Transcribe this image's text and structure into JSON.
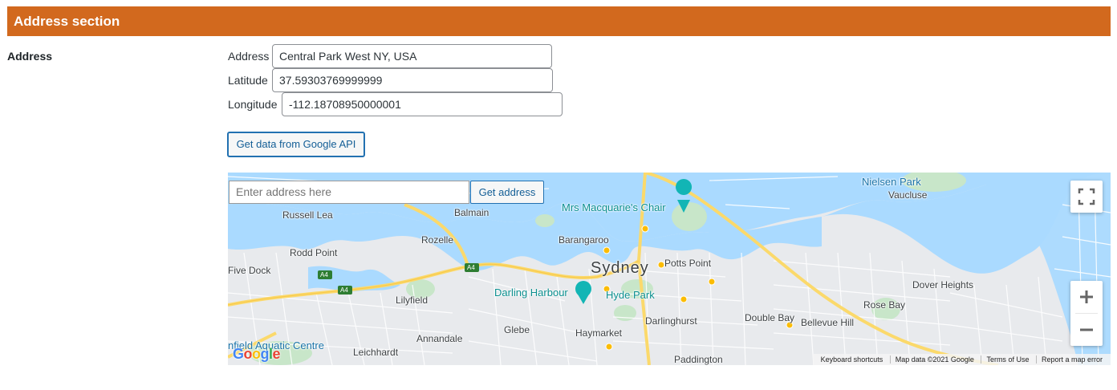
{
  "section": {
    "title": "Address section"
  },
  "field": {
    "label": "Address"
  },
  "address": {
    "label": "Address",
    "value": "Central Park West NY, USA"
  },
  "latitude": {
    "label": "Latitude",
    "value": "37.59303769999999"
  },
  "longitude": {
    "label": "Longitude",
    "value": "-112.18708950000001"
  },
  "api_button": {
    "label": "Get data from Google API"
  },
  "map": {
    "search_placeholder": "Enter address here",
    "get_button": "Get address",
    "places": {
      "sydney": "Sydney",
      "balmain": "Balmain",
      "russell_lea": "Russell Lea",
      "rozelle": "Rozelle",
      "rodd_point": "Rodd Point",
      "five_dock": "Five Dock",
      "lilyfield": "Lilyfield",
      "annandale": "Annandale",
      "leichhardt": "Leichhardt",
      "glebe": "Glebe",
      "haymarket": "Haymarket",
      "barangaroo": "Barangaroo",
      "hyde_park": "Hyde Park",
      "darling_harbour": "Darling Harbour",
      "mrs_macquaries_chair": "Mrs Macquarie's Chair",
      "potts_point": "Potts Point",
      "darlinghurst": "Darlinghurst",
      "paddington": "Paddington",
      "double_bay": "Double Bay",
      "bellevue_hill": "Bellevue Hill",
      "rose_bay": "Rose Bay",
      "dover_heights": "Dover Heights",
      "vaucluse": "Vaucluse",
      "nielsen_park": "Nielsen Park",
      "aquatic_centre": "nfield Aquatic Centre",
      "a4_1": "A4",
      "a4_2": "A4",
      "a4_3": "A4"
    },
    "footer": {
      "keyboard": "Keyboard shortcuts",
      "map_data": "Map data ©2021 Google",
      "terms": "Terms of Use",
      "report": "Report a map error"
    },
    "logo": "Google"
  },
  "colors": {
    "header_bg": "#d2691e",
    "button_border": "#2271b1",
    "water": "#aadaff",
    "land": "#e8eaed",
    "park": "#c8e6c9",
    "highway": "#fbd96b"
  },
  "icons": {
    "fullscreen": "fullscreen-icon",
    "zoom_in": "plus-icon",
    "zoom_out": "minus-icon",
    "attraction": "camera-pin-icon",
    "landmark": "castle-pin-icon"
  }
}
